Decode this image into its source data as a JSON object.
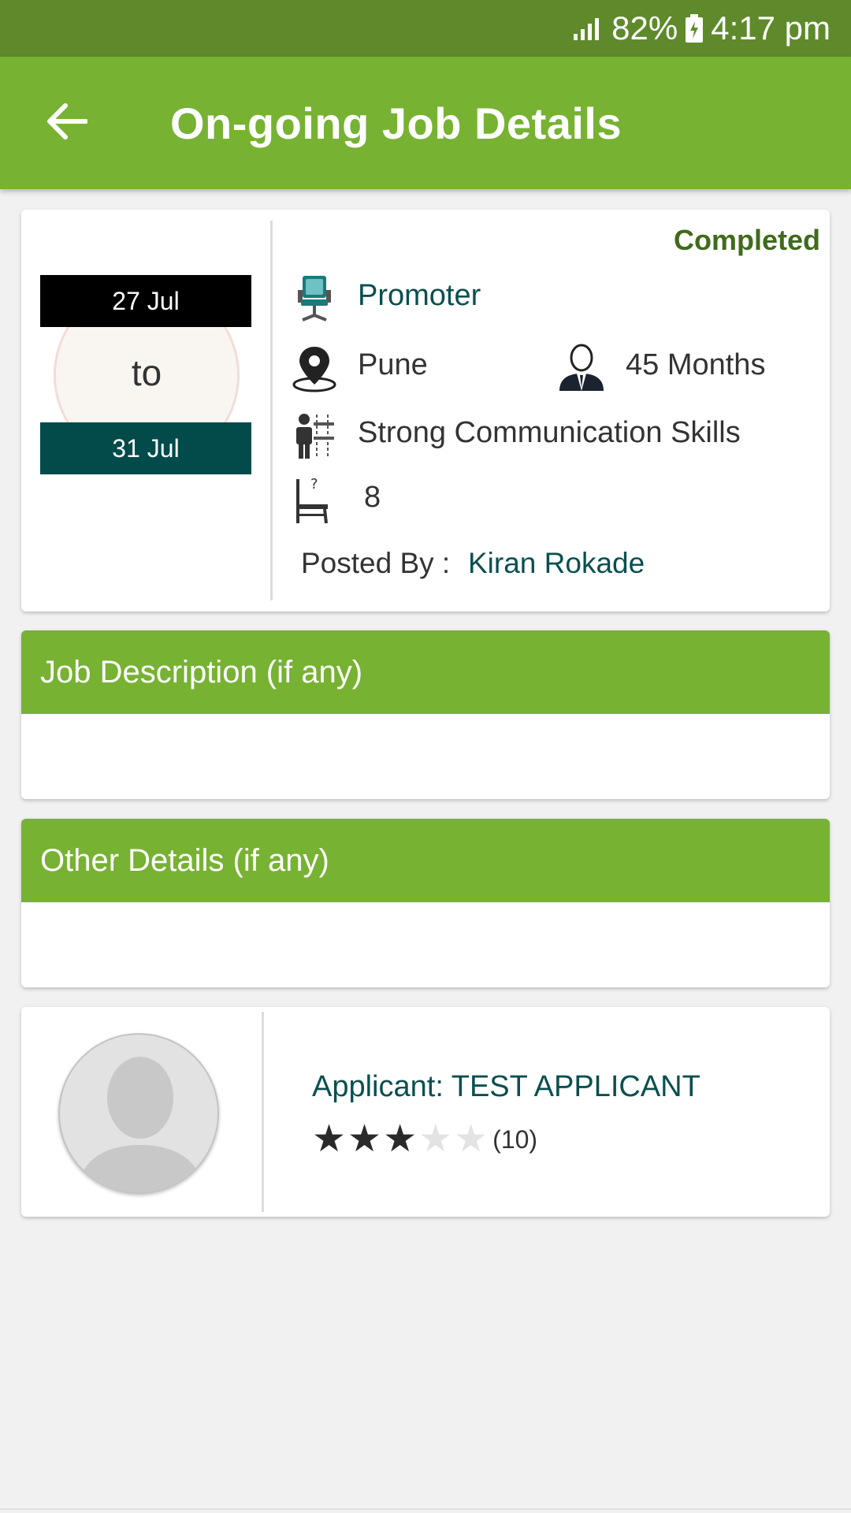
{
  "status_bar": {
    "battery": "82%",
    "time": "4:17 pm"
  },
  "app_bar": {
    "title": "On-going Job Details"
  },
  "job": {
    "status": "Completed",
    "start_date": "27 Jul",
    "date_separator": "to",
    "end_date": "31 Jul",
    "role": "Promoter",
    "location": "Pune",
    "experience": "45 Months",
    "skills": "Strong Communication Skills",
    "vacancies": "8",
    "posted_by_label": "Posted By :",
    "posted_by_name": "Kiran Rokade"
  },
  "sections": {
    "job_description_title": "Job Description (if any)",
    "other_details_title": "Other Details (if any)"
  },
  "applicant": {
    "label": "Applicant: TEST APPLICANT",
    "rating_value": 3,
    "rating_max": 5,
    "rating_count": "(10)"
  },
  "colors": {
    "primary": "#77b233",
    "status_bar": "#5f8a2b",
    "accent_teal": "#0b4f4f",
    "completed_green": "#3f6b1b"
  }
}
